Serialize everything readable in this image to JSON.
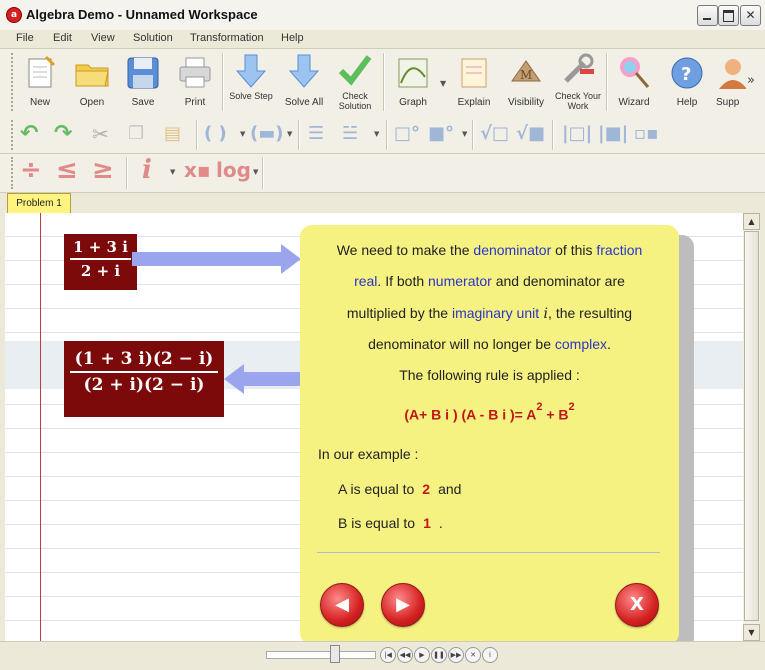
{
  "window": {
    "title": "Algebra Demo - Unnamed Workspace"
  },
  "menu": [
    "File",
    "Edit",
    "View",
    "Solution",
    "Transformation",
    "Help"
  ],
  "toolbar": {
    "new": "New",
    "open": "Open",
    "save": "Save",
    "print": "Print",
    "solve_step": "Solve Step",
    "solve_all": "Solve All",
    "check_solution": "Check Solution",
    "graph": "Graph",
    "explain": "Explain",
    "visibility": "Visibility",
    "check_work": "Check Your Work",
    "wizard": "Wizard",
    "help": "Help",
    "support": "Supp",
    "more": "»"
  },
  "tabs": {
    "problem1": "Problem 1"
  },
  "math": {
    "box1": {
      "num": "1 + 3 i",
      "den": "2 + i"
    },
    "box2": {
      "num": "(1 + 3 i)(2 − i)",
      "den": "(2 + i)(2 − i)"
    }
  },
  "explanation": {
    "l1a": "We need to make the ",
    "l1b": "denominator",
    "l1c": " of this ",
    "l1d": "fraction",
    "l2a": "real",
    "l2b": ". If both ",
    "l2c": "numerator",
    "l2d": " and denominator are",
    "l3a": "multiplied by the ",
    "l3b": "imaginary unit",
    "l3c": " i",
    "l3d": ", the resulting",
    "l4a": "denominator will no longer be ",
    "l4b": "complex",
    "l4c": ".",
    "l5": "The following rule is applied :",
    "rule": "(A+ B i ) (A - B i )= A",
    "rule_exp1": "2",
    "rule_mid": " + B",
    "rule_exp2": "2",
    "example_intro": "In our example :",
    "a_label": "A is equal to",
    "a_value": "2",
    "a_tail": "and",
    "b_label": "B is equal to",
    "b_value": "1",
    "b_tail": "."
  },
  "buttons": {
    "prev": "◀",
    "next": "▶",
    "close": "X"
  }
}
